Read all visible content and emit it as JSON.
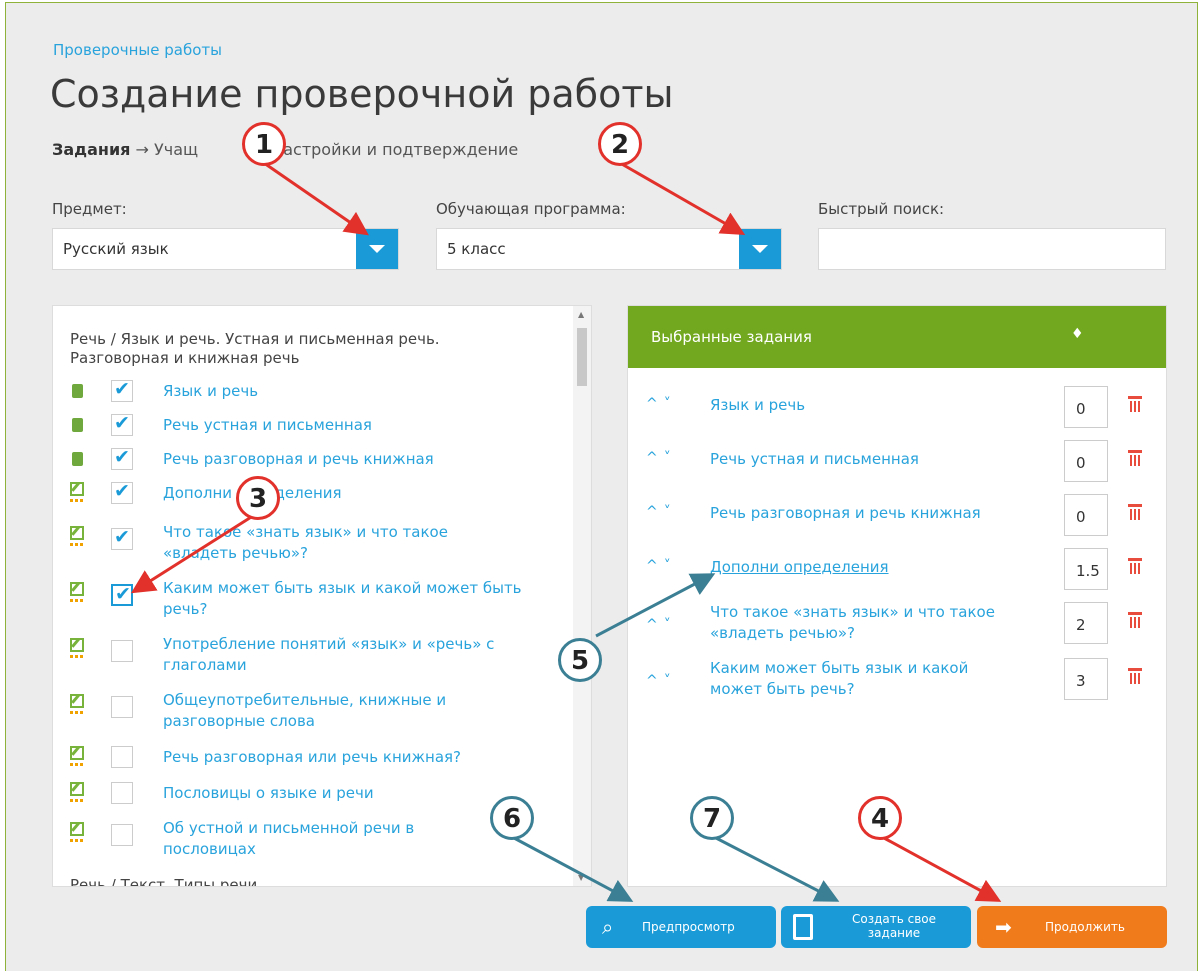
{
  "breadcrumb": "Проверочные работы",
  "title": "Создание проверочной работы",
  "steps": {
    "active": "Задания",
    "arrow": "→",
    "second": "Учащ",
    "third": "Настройки и подтверждение"
  },
  "filters": {
    "subject": {
      "label": "Предмет:",
      "value": "Русский язык"
    },
    "program": {
      "label": "Обучающая программа:",
      "value": "5 класс"
    },
    "search": {
      "label": "Быстрый поиск:",
      "value": ""
    }
  },
  "task_list": {
    "group_title": "Речь / Язык и речь. Устная и письменная речь. Разговорная и книжная речь",
    "items": [
      {
        "label": "Язык и речь",
        "icon": "book-icon",
        "checked": true
      },
      {
        "label": "Речь устная и письменная",
        "icon": "book-icon",
        "checked": true
      },
      {
        "label": "Речь разговорная и речь книжная",
        "icon": "book-icon",
        "checked": true
      },
      {
        "label": "Дополни определения",
        "icon": "edit-icon",
        "checked": true
      },
      {
        "label": "Что такое «знать язык» и что такое «владеть речью»?",
        "icon": "edit-icon",
        "checked": true
      },
      {
        "label": "Каким может быть язык и какой может быть речь?",
        "icon": "edit-icon",
        "checked": true
      },
      {
        "label": "Употребление понятий «язык» и «речь» с глаголами",
        "icon": "edit-icon",
        "checked": false
      },
      {
        "label": "Общеупотребительные, книжные и разговорные слова",
        "icon": "edit-icon",
        "checked": false
      },
      {
        "label": "Речь разговорная или речь книжная?",
        "icon": "edit-icon",
        "checked": false
      },
      {
        "label": "Пословицы о языке и речи",
        "icon": "edit-icon",
        "checked": false
      },
      {
        "label": "Об устной и письменной речи в пословицах",
        "icon": "edit-icon",
        "checked": false
      }
    ],
    "next_group": "Речь / Текст. Типы речи"
  },
  "selected": {
    "header": "Выбранные задания",
    "header_icon": "♦",
    "items": [
      {
        "label": "Язык и речь",
        "points": "0"
      },
      {
        "label": "Речь устная и письменная",
        "points": "0"
      },
      {
        "label": "Речь разговорная и речь книжная",
        "points": "0"
      },
      {
        "label": "Дополни определения",
        "points": "1.5"
      },
      {
        "label": "Что такое «знать язык» и что такое «владеть речью»?",
        "points": "2"
      },
      {
        "label": "Каким может быть язык и какой может быть речь?",
        "points": "3"
      }
    ]
  },
  "buttons": {
    "preview": "Предпросмотр",
    "create": "Создать свое задание",
    "continue": "Продолжить"
  },
  "callouts": [
    "1",
    "2",
    "3",
    "4",
    "5",
    "6",
    "7"
  ]
}
